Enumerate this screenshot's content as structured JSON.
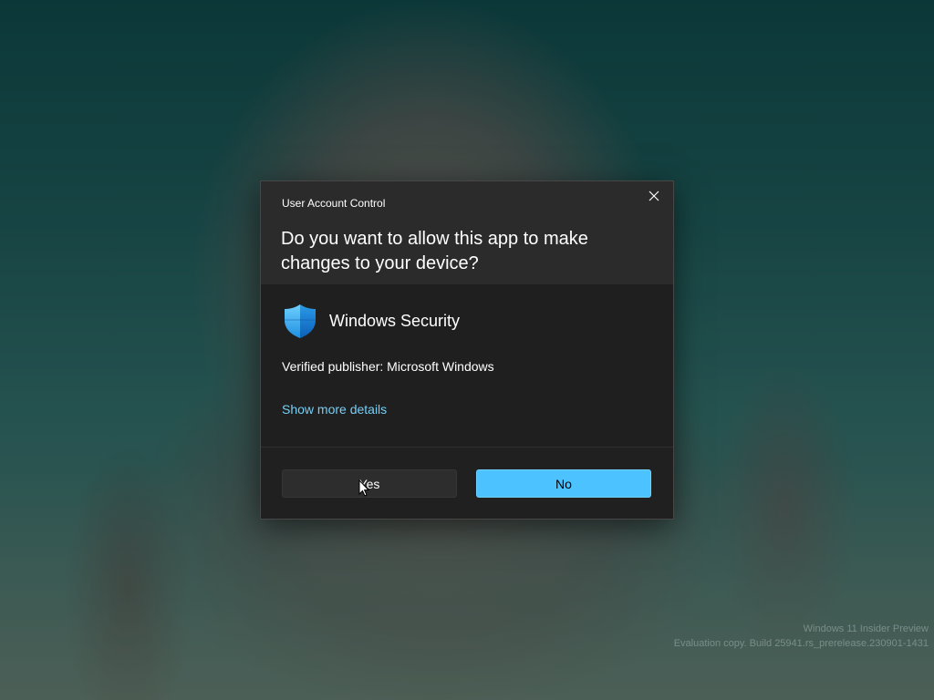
{
  "dialog": {
    "title": "User Account Control",
    "question": "Do you want to allow this app to make changes to your device?",
    "app_name": "Windows Security",
    "app_icon": "windows-security-shield-icon",
    "publisher": "Verified publisher: Microsoft Windows",
    "details_link": "Show more details",
    "yes_label": "Yes",
    "no_label": "No",
    "close_icon": "close-icon"
  },
  "watermark": {
    "line1": "Windows 11 Insider Preview",
    "line2": "Evaluation copy. Build 25941.rs_prerelease.230901-1431"
  },
  "colors": {
    "accent": "#4cc2ff",
    "link": "#78cff5",
    "dialog_header": "#2b2b2b",
    "dialog_body": "#1f1f1f"
  }
}
